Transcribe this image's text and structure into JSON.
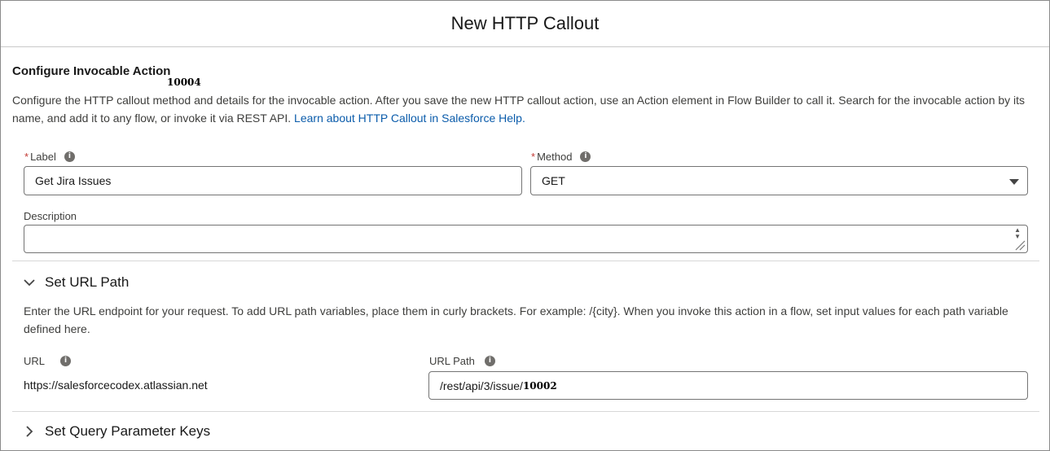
{
  "modal": {
    "title": "New HTTP Callout"
  },
  "configure": {
    "title": "Configure Invocable Action",
    "marker": "10004",
    "description": "Configure the HTTP callout method and details for the invocable action. After you save the new HTTP callout action, use an Action element in Flow Builder to call it. Search for the invocable action by its name, and add it to any flow, or invoke it via REST API.",
    "help_link": "Learn about HTTP Callout in Salesforce Help."
  },
  "fields": {
    "required_mark": "*",
    "label": {
      "label": "Label",
      "value": "Get Jira Issues"
    },
    "method": {
      "label": "Method",
      "value": "GET"
    },
    "description": {
      "label": "Description",
      "value": ""
    }
  },
  "url_section": {
    "title": "Set URL Path",
    "help": "Enter the URL endpoint for your request. To add URL path variables, place them in curly brackets. For example: /{city}. When you invoke this action in a flow, set input values for each path variable defined here.",
    "url_label": "URL",
    "url_value": "https://salesforcecodex.atlassian.net",
    "path_label": "URL Path",
    "path_value": "/rest/api/3/issue/",
    "path_marker": "10002"
  },
  "query_section": {
    "title": "Set Query Parameter Keys"
  },
  "icons": {
    "info": "info-icon",
    "expand": "chevron-down-icon",
    "collapse": "chevron-right-icon"
  }
}
